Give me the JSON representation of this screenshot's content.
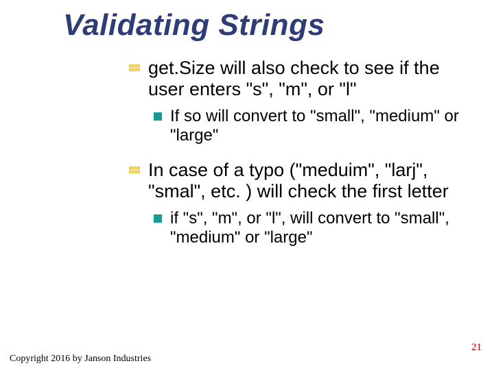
{
  "title": "Validating Strings",
  "bullets": {
    "item1": {
      "text": "get.Size will also check to see if the user enters \"s\", \"m\", or \"l\"",
      "sub": {
        "text": "If so will convert to \"small\", \"medium\" or \"large\""
      }
    },
    "item2": {
      "text": "In case of a typo (\"meduim\", \"larj\", \"smal\", etc. ) will check the first letter",
      "sub": {
        "text": "if \"s\", \"m\", or \"l\", will convert to \"small\", \"medium\" or \"large\""
      }
    }
  },
  "footer": "Copyright 2016 by Janson Industries",
  "page_number": "21",
  "colors": {
    "title": "#2e3d75",
    "sub_bullet": "#169c90",
    "top_bullet_fill": "#f5d66a",
    "top_bullet_stroke": "#c9a400",
    "page_number": "#b10000"
  }
}
